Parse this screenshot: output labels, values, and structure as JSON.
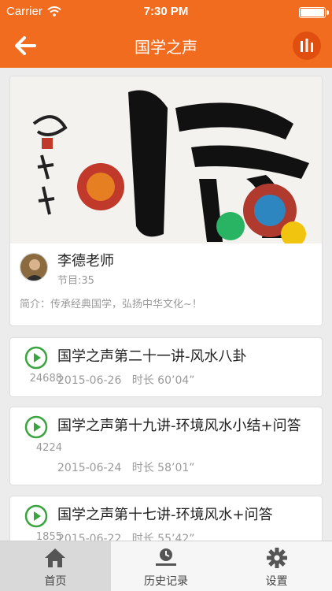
{
  "status_bar": {
    "carrier": "Carrier",
    "time": "7:30 PM",
    "battery_level": 1.0
  },
  "nav": {
    "title": "国学之声"
  },
  "hero": {
    "author_name": "李德老师",
    "program_count": "节目:35",
    "intro": "简介：传承经典国学，弘扬中华文化~！"
  },
  "episodes": [
    {
      "title": "国学之声第二十一讲-风水八卦",
      "plays": "24688",
      "date": "2015-06-26",
      "duration": "时长 60’04”"
    },
    {
      "title": "国学之声第十九讲-环境风水小结+问答",
      "plays": "4224",
      "date": "2015-06-24",
      "duration": "时长 58’01”"
    },
    {
      "title": "国学之声第十七讲-环境风水+问答",
      "plays": "1855",
      "date": "2015-06-22",
      "duration": "时长 55’42”"
    }
  ],
  "tabs": [
    {
      "label": "首页",
      "icon": "home-icon",
      "active": true
    },
    {
      "label": "历史记录",
      "icon": "history-icon",
      "active": false
    },
    {
      "label": "设置",
      "icon": "gear-icon",
      "active": false
    }
  ],
  "colors": {
    "accent": "#f26c1f",
    "play_green": "#3aa53f",
    "tab_active_bg": "#d9d9d9"
  }
}
